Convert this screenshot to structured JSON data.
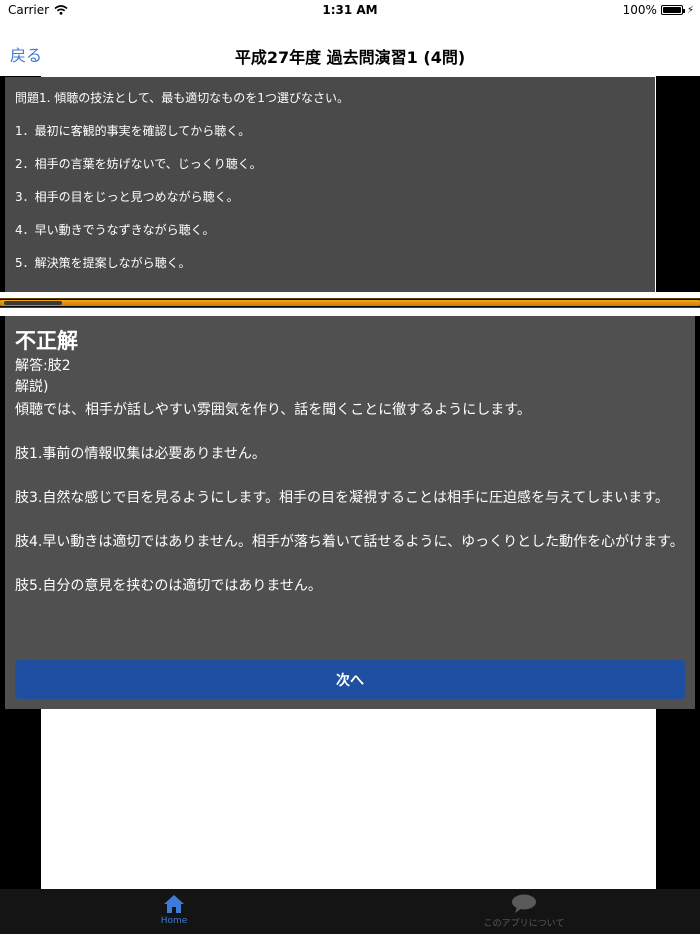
{
  "status": {
    "carrier": "Carrier",
    "time": "1:31 AM",
    "battery": "100%"
  },
  "nav": {
    "back_label": "戻る",
    "title": "平成27年度 過去問演習1 (4問)"
  },
  "question": {
    "prompt": "問題1. 傾聴の技法として、最も適切なものを1つ選びなさい。",
    "options": [
      "1．最初に客観的事実を確認してから聴く。",
      "2．相手の言葉を妨げないで、じっくり聴く。",
      "3．相手の目をじっと見つめながら聴く。",
      "4．早い動きでうなずきながら聴く。",
      "5．解決策を提案しながら聴く。"
    ]
  },
  "progress": {
    "value": 1.0
  },
  "answer": {
    "result": "不正解",
    "answer_line": "解答:肢2",
    "explanation_label": "解説)",
    "explanation_intro": "傾聴では、相手が話しやすい雰囲気を作り、話を聞くことに徹するようにします。",
    "notes": [
      "肢1.事前の情報収集は必要ありません。",
      "肢3.自然な感じで目を見るようにします。相手の目を凝視することは相手に圧迫感を与えてしまいます。",
      "肢4.早い動きは適切ではありません。相手が落ち着いて話せるように、ゆっくりとした動作を心がけます。",
      "肢5.自分の意見を挟むのは適切ではありません。"
    ],
    "next_label": "次へ"
  },
  "tabs": [
    {
      "label": "Home",
      "icon": "home-icon",
      "selected": true
    },
    {
      "label": "このアプリについて",
      "icon": "chat-bubble-icon",
      "selected": false
    }
  ],
  "colors": {
    "accent": "#3d7bd8",
    "button": "#1f4fa1",
    "progress": "#f1a61a"
  }
}
